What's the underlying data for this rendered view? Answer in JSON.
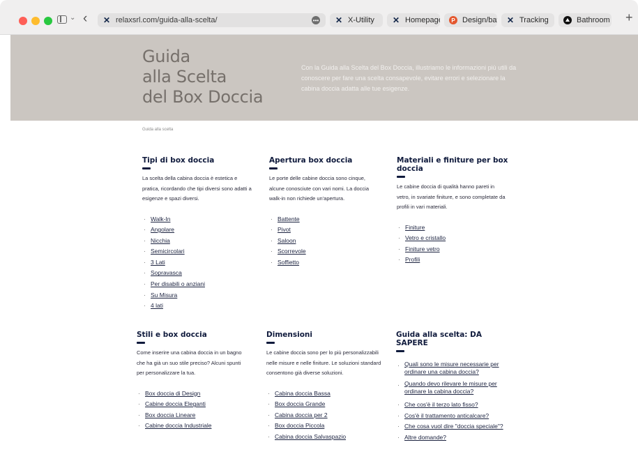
{
  "browser": {
    "url": "relaxsrl.com/guida-alla-scelta/",
    "tabs": [
      {
        "label": "X-Utility",
        "icon": "x-logo-icon"
      },
      {
        "label": "Homepage",
        "icon": "x-logo-icon"
      },
      {
        "label": "Design/bat.",
        "icon": "p-logo-icon"
      },
      {
        "label": "Tracking",
        "icon": "x-logo-icon"
      },
      {
        "label": "Bathroom",
        "icon": "triangle-logo-icon"
      }
    ],
    "page_menu_glyph": "•••",
    "new_tab_glyph": "+",
    "back_glyph": "‹",
    "sidebar_chevron": "⌄"
  },
  "hero": {
    "title_lines": [
      "Guida",
      "alla Scelta",
      "del Box Doccia"
    ],
    "description": "Con la Guida alla Scelta del Box Doccia, illustriamo le informazioni più utili da conoscere per fare una scelta consapevole, evitare errori e selezionare la cabina doccia adatta alle tue esigenze."
  },
  "breadcrumb": "Guida alla scelta",
  "sections": [
    {
      "title": "Tipi di box doccia",
      "text": "La scelta della cabina doccia è estetica e pratica, ricordando che tipi diversi sono adatti a esigenze e spazi diversi.",
      "links": [
        "Walk-In",
        "Angolare",
        "Nicchia",
        "Semicircolari",
        "3 Lati",
        "Sopravasca",
        "Per disabili o anziani",
        "Su Misura",
        "4 lati"
      ]
    },
    {
      "title": "Apertura box doccia",
      "text": "Le porte delle cabine doccia sono cinque, alcune conosciute con vari nomi. La doccia walk-in non richiede un'apertura.",
      "links": [
        "Battente",
        "Pivot",
        "Saloon",
        "Scorrevole",
        "Soffietto"
      ]
    },
    {
      "title": "Materiali e finiture per box doccia",
      "text": "Le cabine doccia di qualità hanno pareti in vetro, in svariate finiture, e sono completate da profili in vari materiali.",
      "links": [
        "Finiture",
        "Vetro e cristallo",
        "Finiture vetro",
        "Profili"
      ]
    },
    {
      "title": "Stili e box doccia",
      "text": "Come inserire una cabina doccia in un bagno che ha già un suo stile preciso? Alcuni spunti per personalizzare la tua.",
      "links": [
        "Box doccia di Design",
        "Cabine doccia Eleganti",
        "Box doccia Lineare",
        "Cabine doccia Industriale"
      ]
    },
    {
      "title": "Dimensioni",
      "text": "Le cabine doccia sono per lo più personalizzabili nelle misure e nelle finiture. Le soluzioni standard consentono già diverse soluzioni.",
      "links": [
        "Cabina doccia Bassa",
        "Box doccia Grande",
        "Cabina doccia per 2",
        "Box doccia Piccola",
        "Cabina doccia Salvaspazio"
      ]
    },
    {
      "title": "Guida alla scelta: DA SAPERE",
      "text": "",
      "links": [
        "Quali sono le misure necessarie per ordinare una cabina doccia?",
        "Quando devo rilevare le misure per ordinare la cabina doccia?",
        "Che cos'è il terzo lato fisso?",
        "Cos'è il trattamento anticalcare?",
        "Che cosa vuol dire \"doccia speciale\"?",
        "Altre domande?"
      ]
    }
  ]
}
